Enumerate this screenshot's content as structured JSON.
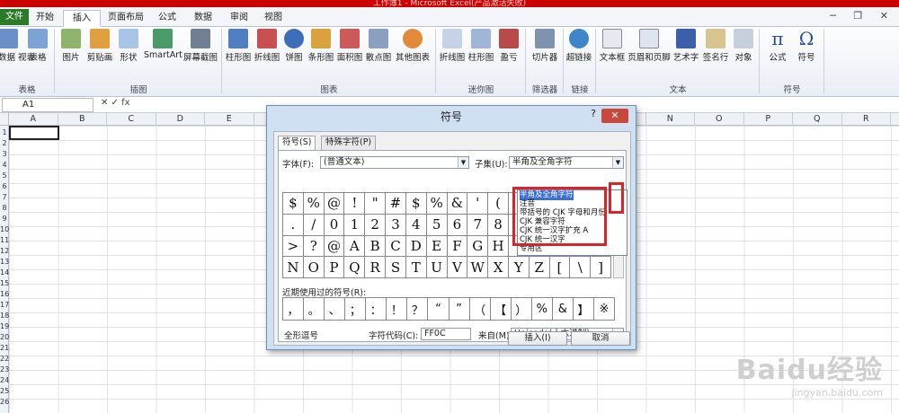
{
  "window": {
    "title": "工作簿1 - Microsoft Excel(产品激活失败)",
    "controls": "─ ❐ ✕"
  },
  "ribbon_tabs": [
    "文件",
    "开始",
    "插入",
    "页面布局",
    "公式",
    "数据",
    "审阅",
    "视图"
  ],
  "ribbon": {
    "groups": {
      "table": "表格",
      "illustrations": "插图",
      "charts": "图表",
      "sparklines": "迷你图",
      "filter": "筛选器",
      "links": "链接",
      "text": "文本",
      "symbols": "符号"
    },
    "buttons": {
      "pivot": "数据\n视表",
      "table": "表格",
      "picture": "图片",
      "clipart": "剪贴画",
      "shapes": "形状",
      "smartart": "SmartArt",
      "screenshot": "屏幕截图",
      "column": "柱形图",
      "line": "折线图",
      "pie": "饼图",
      "bar": "条形图",
      "area": "面积图",
      "scatter": "散点图",
      "other": "其他图表",
      "sp_line": "折线图",
      "sp_column": "柱形图",
      "sp_winloss": "盈亏",
      "slicer": "切片器",
      "hyperlink": "超链接",
      "textbox": "文本框",
      "headerfooter": "页眉和页脚",
      "wordart": "艺术字",
      "signature": "签名行",
      "object": "对象",
      "equation": "公式",
      "symbol": "符号"
    }
  },
  "formula_bar": {
    "name_box": "A1",
    "icons": "✕ ✓ fx",
    "formula": ""
  },
  "columns": [
    "A",
    "B",
    "C",
    "D",
    "E",
    "F",
    "G",
    "H",
    "I",
    "J",
    "K",
    "L",
    "M",
    "N",
    "O",
    "P",
    "Q",
    "R"
  ],
  "rows": [
    "1",
    "2",
    "3",
    "4",
    "5",
    "6",
    "7",
    "8",
    "9",
    "10",
    "11",
    "12",
    "13",
    "14",
    "15",
    "16",
    "17",
    "18",
    "19",
    "20",
    "21",
    "22",
    "23",
    "24",
    "25",
    "26"
  ],
  "dialog": {
    "title": "符号",
    "help": "?",
    "close": "✕",
    "tab_symbols": "符号(S)",
    "tab_special": "特殊字符(P)",
    "font_label": "字体(F):",
    "font_value": "(普通文本)",
    "subset_label": "子集(U):",
    "subset_value": "半角及全角字符",
    "symbols": [
      "$",
      "%",
      "@",
      "!",
      "\"",
      "#",
      "$",
      "%",
      "&",
      "'",
      "(",
      "",
      "",
      "",
      "",
      "",
      ".",
      "/",
      "0",
      "1",
      "2",
      "3",
      "4",
      "5",
      "6",
      "7",
      "8",
      "",
      "",
      "",
      "",
      "",
      ">",
      "?",
      "@",
      "A",
      "B",
      "C",
      "D",
      "E",
      "F",
      "G",
      "H",
      "",
      "",
      "",
      "",
      "",
      "N",
      "O",
      "P",
      "Q",
      "R",
      "S",
      "T",
      "U",
      "V",
      "W",
      "X",
      "Y",
      "Z",
      "[",
      "\\",
      "]"
    ],
    "subset_options": [
      "半角及全角字符",
      "注音",
      "带括号的 CJK 字母和月份",
      "CJK 兼容字符",
      "CJK 统一汉字扩充 A",
      "CJK 统一汉字",
      "专用区"
    ],
    "recent_label": "近期使用过的符号(R):",
    "recent": [
      "，",
      "。",
      "、",
      "；",
      "：",
      "！",
      "？",
      "“",
      "”",
      "（",
      "【",
      "）",
      "%",
      "&",
      "】",
      "※"
    ],
    "char_name": "全形逗号",
    "char_code_label": "字符代码(C):",
    "char_code_value": "FF0C",
    "from_label": "来自(M):",
    "from_value": "Unicode(十六进制)",
    "insert_button": "插入(I)",
    "cancel_button": "取消"
  },
  "watermark": {
    "brand": "Baidu经验",
    "url": "jingyan.baidu.com"
  },
  "colors": {
    "accent_red": "#d9242a",
    "title_red": "#cc0000",
    "file_tab": "#2a7a2a"
  }
}
